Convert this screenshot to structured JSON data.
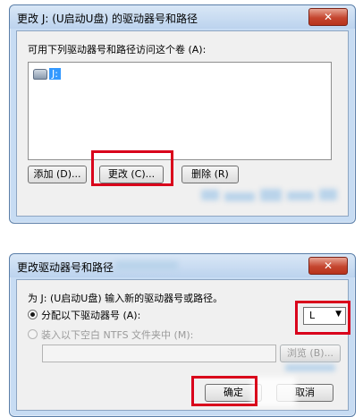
{
  "dialog1": {
    "title": "更改 J: (U启动U盘) 的驱动器号和路径",
    "instruction": "可用下列驱动器号和路径访问这个卷 (A):",
    "list_items": [
      {
        "label": "J:"
      }
    ],
    "buttons": {
      "add": "添加 (D)...",
      "change": "更改 (C)...",
      "remove": "删除 (R)"
    },
    "close": "✕"
  },
  "dialog2": {
    "title": "更改驱动器号和路径",
    "prompt": "为 J: (U启动U盘) 输入新的驱动器号或路径。",
    "option_assign": "分配以下驱动器号 (A):",
    "option_mount": "装入以下空白 NTFS 文件夹中 (M):",
    "selected_letter": "L",
    "browse": "浏览 (B)...",
    "ok": "确定",
    "cancel": "取消",
    "close": "✕"
  },
  "colors": {
    "highlight": "#d9001b",
    "selection": "#3399ff"
  }
}
